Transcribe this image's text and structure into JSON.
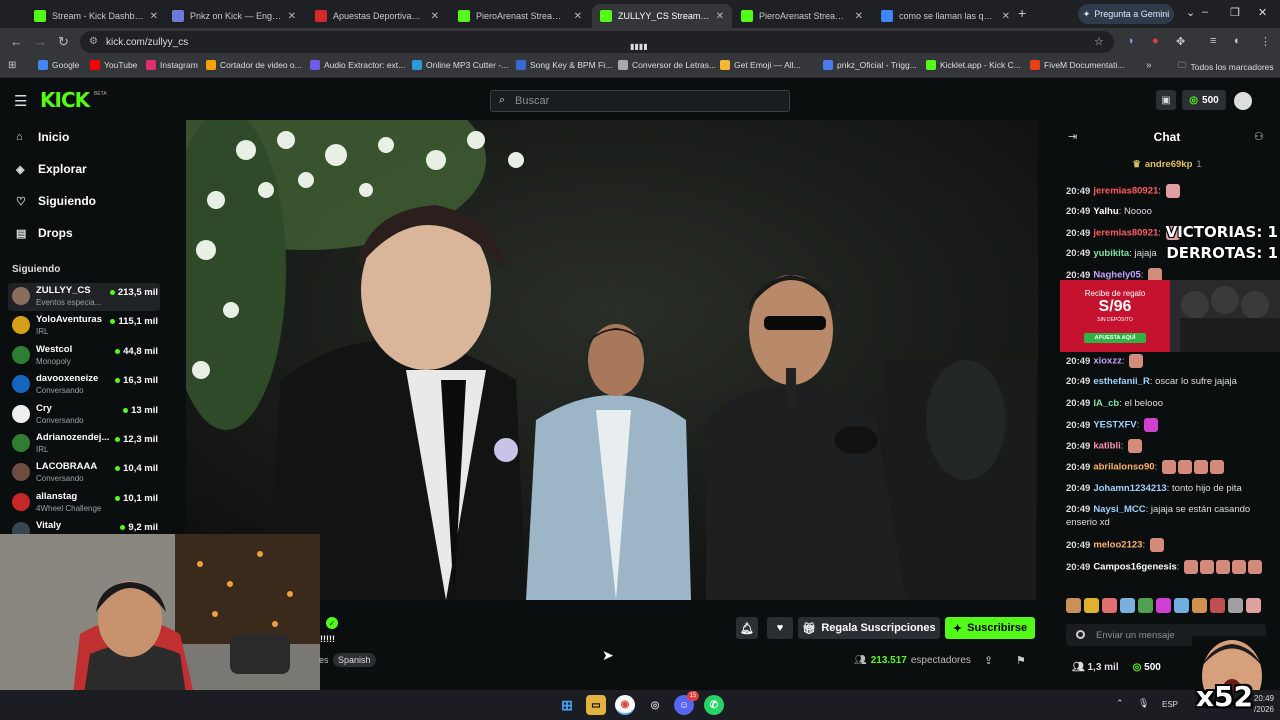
{
  "browser": {
    "tabs": [
      {
        "title": "Stream - Kick Dashboard",
        "favicon_color": "#53fc18",
        "active": false
      },
      {
        "title": "Pnkz on Kick — Engagement",
        "favicon_color": "#6c7bd8",
        "active": false
      },
      {
        "title": "Apuestas Deportivas con C",
        "favicon_color": "#d62828",
        "active": false
      },
      {
        "title": "PieroArenast Stream - Wa",
        "favicon_color": "#53fc18",
        "active": false
      },
      {
        "title": "ZULLYY_CS Stream - W",
        "favicon_color": "#53fc18",
        "active": true
      },
      {
        "title": "PieroArenast Stream - Wa",
        "favicon_color": "#53fc18",
        "active": false
      },
      {
        "title": "como se llaman las que ac",
        "favicon_color": "#4285f4",
        "active": false
      }
    ],
    "gemini_button": "Pregunta a Gemini",
    "url": "kick.com/zullyy_cs",
    "media_badge": "▮▮▮▮",
    "bookmarks": [
      {
        "label": "Google",
        "color": "#4285f4"
      },
      {
        "label": "YouTube",
        "color": "#ff0000"
      },
      {
        "label": "Instagram",
        "color": "#e1306c"
      },
      {
        "label": "Cortador de video o...",
        "color": "#f4a300"
      },
      {
        "label": "Audio Extractor: ext...",
        "color": "#6c5ce7"
      },
      {
        "label": "Online MP3 Cutter -...",
        "color": "#2d98da"
      },
      {
        "label": "Song Key & BPM Fi...",
        "color": "#3867d6"
      },
      {
        "label": "Conversor de Letras...",
        "color": "#aaaaaa"
      },
      {
        "label": "Get Emoji — All...",
        "color": "#f7b731"
      },
      {
        "label": "pnkz_Oficial - Trigg...",
        "color": "#4b7bec"
      },
      {
        "label": "Kicklet.app - Kick C...",
        "color": "#53fc18"
      },
      {
        "label": "FiveM Documentati...",
        "color": "#e84118"
      }
    ],
    "all_bookmarks": "Todos los marcadores"
  },
  "kick": {
    "logo": "KICK",
    "beta": "BETA",
    "search_placeholder": "Buscar",
    "points": "500",
    "accent": "#53fc18",
    "nav": [
      {
        "label": "Inicio",
        "icon": "home-icon"
      },
      {
        "label": "Explorar",
        "icon": "compass-icon"
      },
      {
        "label": "Siguiendo",
        "icon": "heart-icon"
      },
      {
        "label": "Drops",
        "icon": "drops-icon"
      }
    ],
    "following_header": "Siguiendo",
    "following": [
      {
        "name": "ZULLYY_CS",
        "category": "Eventos especia...",
        "viewers": "213,5 mil",
        "color": "#8a6d5a"
      },
      {
        "name": "YoloAventuras",
        "category": "IRL",
        "viewers": "115,1 mil",
        "color": "#d4a017"
      },
      {
        "name": "Westcol",
        "category": "Monopoly",
        "viewers": "44,8 mil",
        "color": "#2e7d32"
      },
      {
        "name": "davooxeneize",
        "category": "Conversando",
        "viewers": "16,3 mil",
        "color": "#1565c0"
      },
      {
        "name": "Cry",
        "category": "Conversando",
        "viewers": "13 mil",
        "color": "#eeeeee"
      },
      {
        "name": "Adrianozendej...",
        "category": "IRL",
        "viewers": "12,3 mil",
        "color": "#2e7d32"
      },
      {
        "name": "LACOBRAAA",
        "category": "Conversando",
        "viewers": "10,4 mil",
        "color": "#6d4c41"
      },
      {
        "name": "allanstag",
        "category": "4Wheel Challenge",
        "viewers": "10,1 mil",
        "color": "#c62828"
      },
      {
        "name": "Vitaly",
        "category": "IRL",
        "viewers": "9,2 mil",
        "color": "#37474f"
      }
    ]
  },
  "stream": {
    "exclaim": "!!!!!",
    "prev_text": "es",
    "language_tag": "Spanish",
    "gift_subs": "Regala Suscripciones",
    "subscribe": "Suscribirse",
    "viewers_count": "213.517",
    "viewers_label": "espectadores"
  },
  "chat": {
    "title": "Chat",
    "pinned_user": "andre69kp",
    "pinned_count": "1",
    "messages": [
      {
        "time": "20:49",
        "user": "jeremias80921",
        "color": "#ff5c5c",
        "text": "",
        "emotes": [
          "#e0a0a0"
        ]
      },
      {
        "time": "20:49",
        "user": "Yalhu",
        "color": "#ffffff",
        "text": "Noooo",
        "emotes": []
      },
      {
        "time": "20:49",
        "user": "jeremias80921",
        "color": "#ff5c5c",
        "text": "",
        "emotes": [
          "#e0a0a0"
        ]
      },
      {
        "time": "20:49",
        "user": "yubikita",
        "color": "#7fe3a6",
        "text": "jajaja",
        "emotes": []
      },
      {
        "time": "20:49",
        "user": "Naghely05",
        "color": "#c9a0ff",
        "text": "",
        "emotes": [
          "#d48c7a"
        ]
      },
      {
        "time": "20:49",
        "user": "xioxzz",
        "color": "#c9a0ff",
        "text": "",
        "emotes": [
          "#d48c7a"
        ]
      },
      {
        "time": "20:49",
        "user": "esthefanii_R",
        "color": "#9fd1ff",
        "text": "oscar lo sufre jajaja",
        "emotes": []
      },
      {
        "time": "20:49",
        "user": "IA_cb",
        "color": "#7fe3a6",
        "text": "el belooo",
        "emotes": []
      },
      {
        "time": "20:49",
        "user": "YESTXFV",
        "color": "#9fd1ff",
        "text": "",
        "emotes": [
          "#d040d0"
        ]
      },
      {
        "time": "20:49",
        "user": "katibli",
        "color": "#ff8fb1",
        "text": "",
        "emotes": [
          "#d48c7a"
        ]
      },
      {
        "time": "20:49",
        "user": "abrilalonso90",
        "color": "#ffb36b",
        "text": "",
        "emotes": [
          "#d48c7a",
          "#d48c7a",
          "#d48c7a",
          "#d48c7a"
        ]
      },
      {
        "time": "20:49",
        "user": "Johamn1234213",
        "color": "#9fd1ff",
        "text": "tonto hijo de pita",
        "emotes": []
      },
      {
        "time": "20:49",
        "user": "Naysi_MCC",
        "color": "#9fd1ff",
        "text": "jajaja se están casando enserio xd",
        "emotes": []
      },
      {
        "time": "20:49",
        "user": "meloo2123",
        "color": "#ffb36b",
        "text": "",
        "emotes": [
          "#d48c7a"
        ]
      },
      {
        "time": "20:49",
        "user": "Campos16genesis",
        "color": "#ffffff",
        "text": "",
        "emotes": [
          "#d48c7a",
          "#d48c7a",
          "#d48c7a",
          "#d48c7a",
          "#d48c7a"
        ]
      }
    ],
    "overlay_lines": [
      "VICTORIAS: 1",
      "DERROTAS: 1"
    ],
    "ad_top": "Recibe de regalo",
    "ad_amount": "S/96",
    "ad_sub": "SIN DEPÓSITO",
    "ad_cta": "APUESTA AQUÍ",
    "emote_bar": [
      "#c9905a",
      "#e0b030",
      "#e07070",
      "#7ab0e0",
      "#50a050",
      "#d040d0",
      "#70b0e0",
      "#d09050",
      "#c05050",
      "#a0a0a0",
      "#e0a0a0"
    ],
    "input_placeholder": "Enviar un mensaje",
    "followers": "1,3 mil",
    "points": "500"
  },
  "taskbar": {
    "lang": "ESP",
    "time": "20:49",
    "date": "/2026",
    "discord_badge": "15"
  },
  "overlays": {
    "multiplier": "x52"
  }
}
